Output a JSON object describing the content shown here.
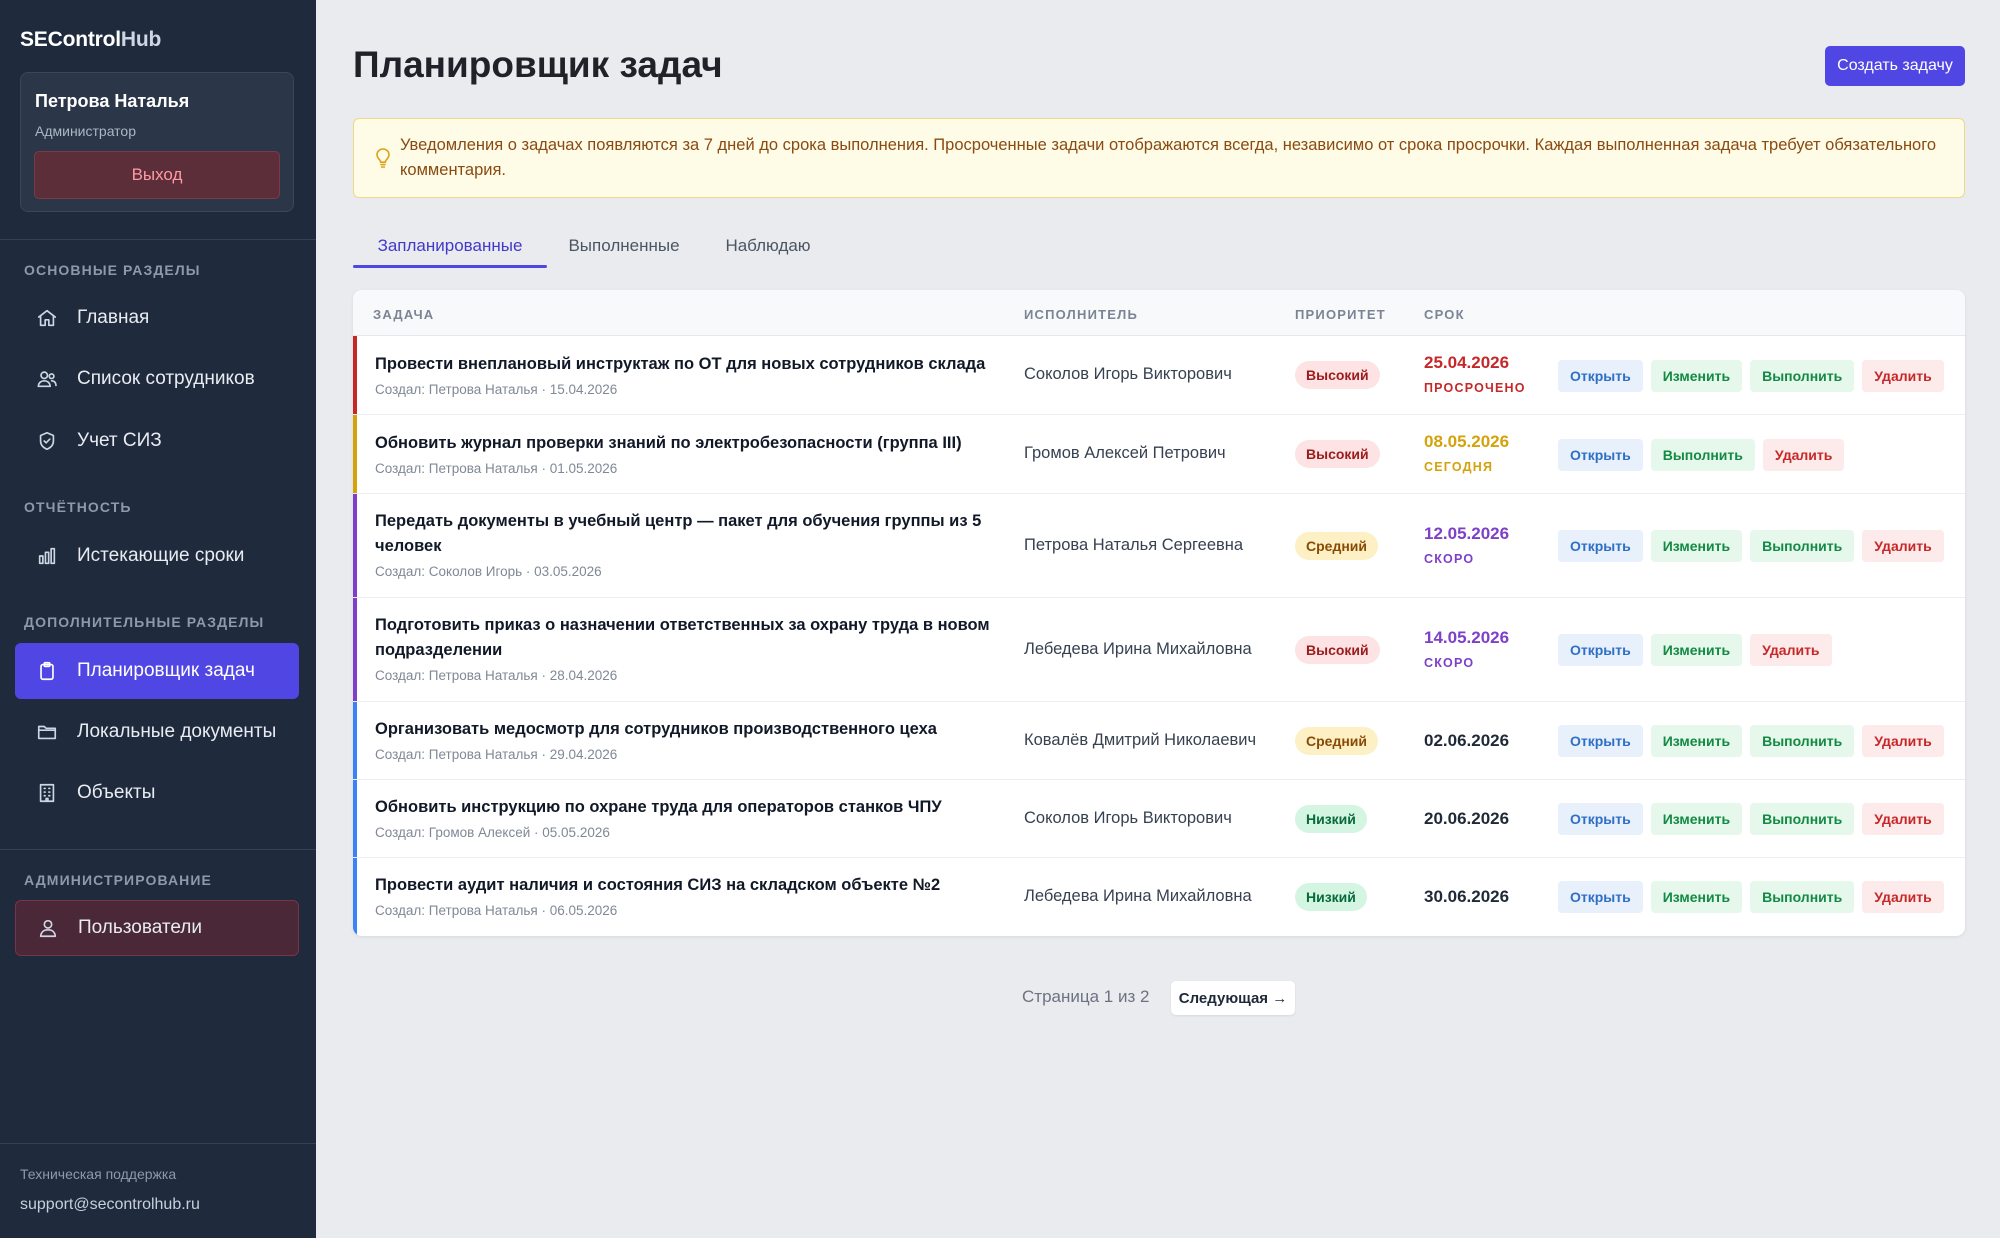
{
  "sidebar": {
    "brand_part1": "SEControl",
    "brand_part2": "Hub",
    "user_name": "Петрова Наталья",
    "user_role": "Администратор",
    "logout_label": "Выход",
    "sections": {
      "main": "ОСНОВНЫЕ РАЗДЕЛЫ",
      "reports": "ОТЧЁТНОСТЬ",
      "extra": "ДОПОЛНИТЕЛЬНЫЕ РАЗДЕЛЫ",
      "admin": "АДМИНИСТРИРОВАНИЕ"
    },
    "items": {
      "home": "Главная",
      "employees": "Список сотрудников",
      "ppe": "Учет СИЗ",
      "expiring": "Истекающие сроки",
      "planner": "Планировщик задач",
      "local_docs": "Локальные документы",
      "objects": "Объекты",
      "users": "Пользователи"
    },
    "support_label": "Техническая поддержка",
    "support_email": "support@secontrolhub.ru"
  },
  "header": {
    "title": "Планировщик задач",
    "create_label": "Создать задачу"
  },
  "notice": "Уведомления о задачах появляются за 7 дней до срока выполнения. Просроченные задачи отображаются всегда, независимо от срока просрочки. Каждая выполненная задача требует обязательного комментария.",
  "tabs": {
    "planned": "Запланированные",
    "completed": "Выполненные",
    "watching": "Наблюдаю"
  },
  "table": {
    "headers": {
      "task": "ЗАДАЧА",
      "assignee": "ИСПОЛНИТЕЛЬ",
      "priority": "ПРИОРИТЕТ",
      "due": "СРОК"
    },
    "actions": {
      "open": "Открыть",
      "edit": "Изменить",
      "complete": "Выполнить",
      "delete": "Удалить"
    },
    "rows": [
      {
        "title": "Провести внеплановый инструктаж по ОТ для новых сотрудников склада",
        "meta": "Создал: Петрова Наталья · 15.04.2026",
        "assignee": "Соколов Игорь Викторович",
        "priority": "Высокий",
        "due": "25.04.2026",
        "due_status": "ПРОСРОЧЕНО"
      },
      {
        "title": "Обновить журнал проверки знаний по электробезопасности (группа III)",
        "meta": "Создал: Петрова Наталья · 01.05.2026",
        "assignee": "Громов Алексей Петрович",
        "priority": "Высокий",
        "due": "08.05.2026",
        "due_status": "СЕГОДНЯ"
      },
      {
        "title": "Передать документы в учебный центр — пакет для обучения группы из 5 человек",
        "meta": "Создал: Соколов Игорь · 03.05.2026",
        "assignee": "Петрова Наталья Сергеевна",
        "priority": "Средний",
        "due": "12.05.2026",
        "due_status": "СКОРО"
      },
      {
        "title": "Подготовить приказ о назначении ответственных за охрану труда в новом подразделении",
        "meta": "Создал: Петрова Наталья · 28.04.2026",
        "assignee": "Лебедева Ирина Михайловна",
        "priority": "Высокий",
        "due": "14.05.2026",
        "due_status": "СКОРО"
      },
      {
        "title": "Организовать медосмотр для сотрудников производственного цеха",
        "meta": "Создал: Петрова Наталья · 29.04.2026",
        "assignee": "Ковалёв Дмитрий Николаевич",
        "priority": "Средний",
        "due": "02.06.2026"
      },
      {
        "title": "Обновить инструкцию по охране труда для операторов станков ЧПУ",
        "meta": "Создал: Громов Алексей · 05.05.2026",
        "assignee": "Соколов Игорь Викторович",
        "priority": "Низкий",
        "due": "20.06.2026"
      },
      {
        "title": "Провести аудит наличия и состояния СИЗ на складском объекте №2",
        "meta": "Создал: Петрова Наталья · 06.05.2026",
        "assignee": "Лебедева Ирина Михайловна",
        "priority": "Низкий",
        "due": "30.06.2026"
      }
    ]
  },
  "pagination": {
    "status": "Страница 1 из 2",
    "next_label": "Следующая →"
  },
  "colors": {
    "accent": "#5046e4",
    "overdue": "#c62828",
    "today": "#d4a20a",
    "soon": "#7e3fc9",
    "normal_stripe": "#3b82f6"
  }
}
